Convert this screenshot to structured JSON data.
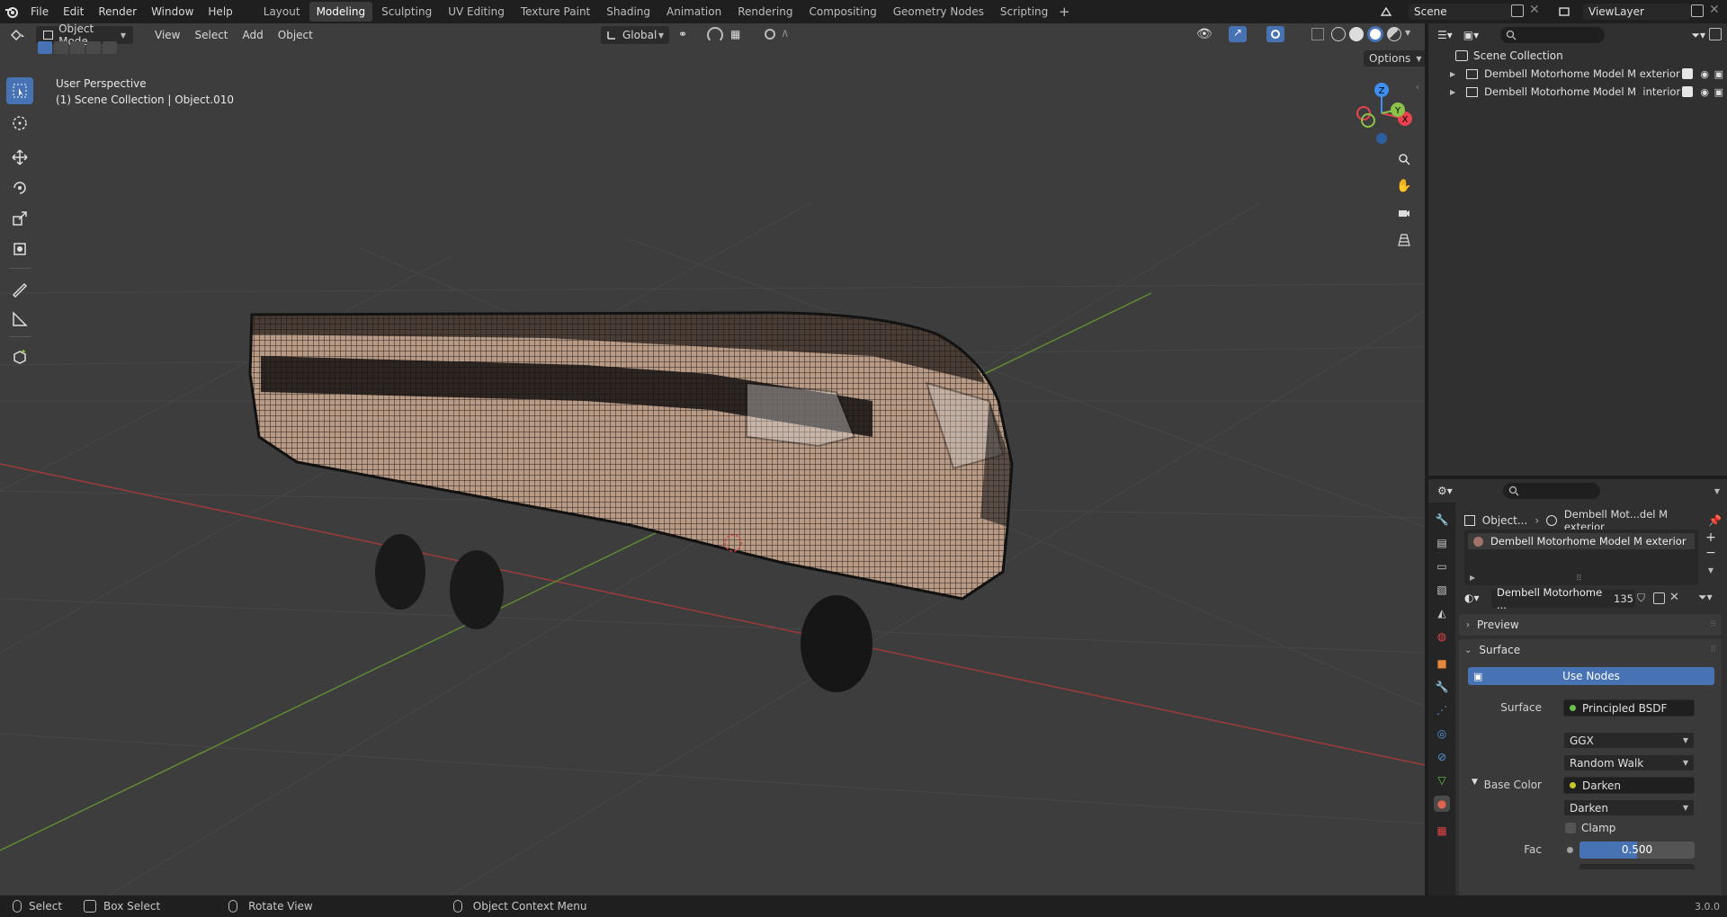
{
  "menu": {
    "file": "File",
    "edit": "Edit",
    "render": "Render",
    "window": "Window",
    "help": "Help"
  },
  "workspaces": [
    {
      "label": "Layout",
      "active": false
    },
    {
      "label": "Modeling",
      "active": true
    },
    {
      "label": "Sculpting",
      "active": false
    },
    {
      "label": "UV Editing",
      "active": false
    },
    {
      "label": "Texture Paint",
      "active": false
    },
    {
      "label": "Shading",
      "active": false
    },
    {
      "label": "Animation",
      "active": false
    },
    {
      "label": "Rendering",
      "active": false
    },
    {
      "label": "Compositing",
      "active": false
    },
    {
      "label": "Geometry Nodes",
      "active": false
    },
    {
      "label": "Scripting",
      "active": false
    }
  ],
  "scene": {
    "name": "Scene",
    "view_layer": "ViewLayer"
  },
  "viewport": {
    "mode": "Object Mode",
    "menus": {
      "view": "View",
      "select": "Select",
      "add": "Add",
      "object": "Object"
    },
    "transform_orientation": "Global",
    "options": "Options",
    "overlay_line1": "User Perspective",
    "overlay_line2": "(1) Scene Collection | Object.010",
    "gizmo": {
      "z": "Z",
      "y": "Y",
      "x": "X"
    }
  },
  "outliner": {
    "root": "Scene Collection",
    "items": [
      {
        "label": "Dembell Motorhome Model M exterior"
      },
      {
        "label": "Dembell Motorhome Model M  interior"
      }
    ]
  },
  "properties": {
    "breadcrumb_object": "Object...",
    "breadcrumb_material": "Dembell Mot...del M exterior",
    "slot": "Dembell Motorhome Model M exterior",
    "material_name": "Dembell Motorhome ...",
    "user_count": "135",
    "panels": {
      "preview": "Preview",
      "surface": "Surface"
    },
    "use_nodes": "Use Nodes",
    "surface_label": "Surface",
    "surface_value": "Principled BSDF",
    "distribution": "GGX",
    "subsurface": "Random Walk",
    "base_color_label": "Base Color",
    "base_color_value": "Darken",
    "blend_mode": "Darken",
    "clamp": "Clamp",
    "fac_label": "Fac",
    "fac_value": "0.500",
    "fac_fraction": 0.5
  },
  "statusbar": {
    "select": "Select",
    "box_select": "Box Select",
    "rotate": "Rotate View",
    "context": "Object Context Menu",
    "version": "3.0.0"
  },
  "colors": {
    "accent": "#4772b3",
    "header": "#1f1f1f",
    "viewport": "#3d3d3d",
    "panel": "#303030",
    "x_axis": "#e8424f",
    "y_axis": "#8bc34a",
    "z_axis": "#3d8ff2"
  }
}
